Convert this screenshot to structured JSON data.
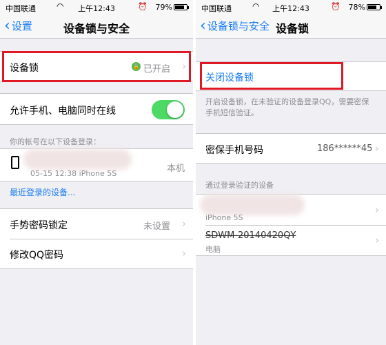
{
  "left_screen": {
    "status": {
      "carrier": "中国联通",
      "time": "上午12:43",
      "battery": "79%",
      "battery_level": 0.79
    },
    "nav": {
      "back_label": "设置",
      "title": "设备锁与安全"
    },
    "device_lock": {
      "label": "设备锁",
      "value": "已开启"
    },
    "allow_online": {
      "label": "允许手机、电脑同时在线",
      "enabled": true
    },
    "login_devices": {
      "caption": "你的帐号在以下设备登录：",
      "device": {
        "detail": "05-15 12:38  iPhone 5S",
        "tag": "本机"
      },
      "recent_link": "最近登录的设备..."
    },
    "gesture_lock": {
      "label": "手势密码锁定",
      "value": "未设置"
    },
    "change_password": {
      "label": "修改QQ密码"
    }
  },
  "right_screen": {
    "status": {
      "carrier": "中国联通",
      "time": "上午12:43",
      "battery": "78%",
      "battery_level": 0.78
    },
    "nav": {
      "back_label": "设备锁与安全",
      "title": "设备锁"
    },
    "disable_lock": {
      "label": "关闭设备锁"
    },
    "description": "开启设备锁，在未验证的设备登录QQ，需要密保手机短信验证。",
    "phone": {
      "label": "密保手机号码",
      "value": "186******45"
    },
    "verified_caption": "通过登录验证的设备",
    "devices": [
      {
        "name": "",
        "type": "iPhone 5S"
      },
      {
        "name": "SDWM-20140420QY",
        "type": "电脑"
      }
    ]
  },
  "colors": {
    "accent": "#1a7cf5",
    "toggle_on": "#4cd964",
    "highlight": "#e01823",
    "lock_green": "#57b947"
  }
}
